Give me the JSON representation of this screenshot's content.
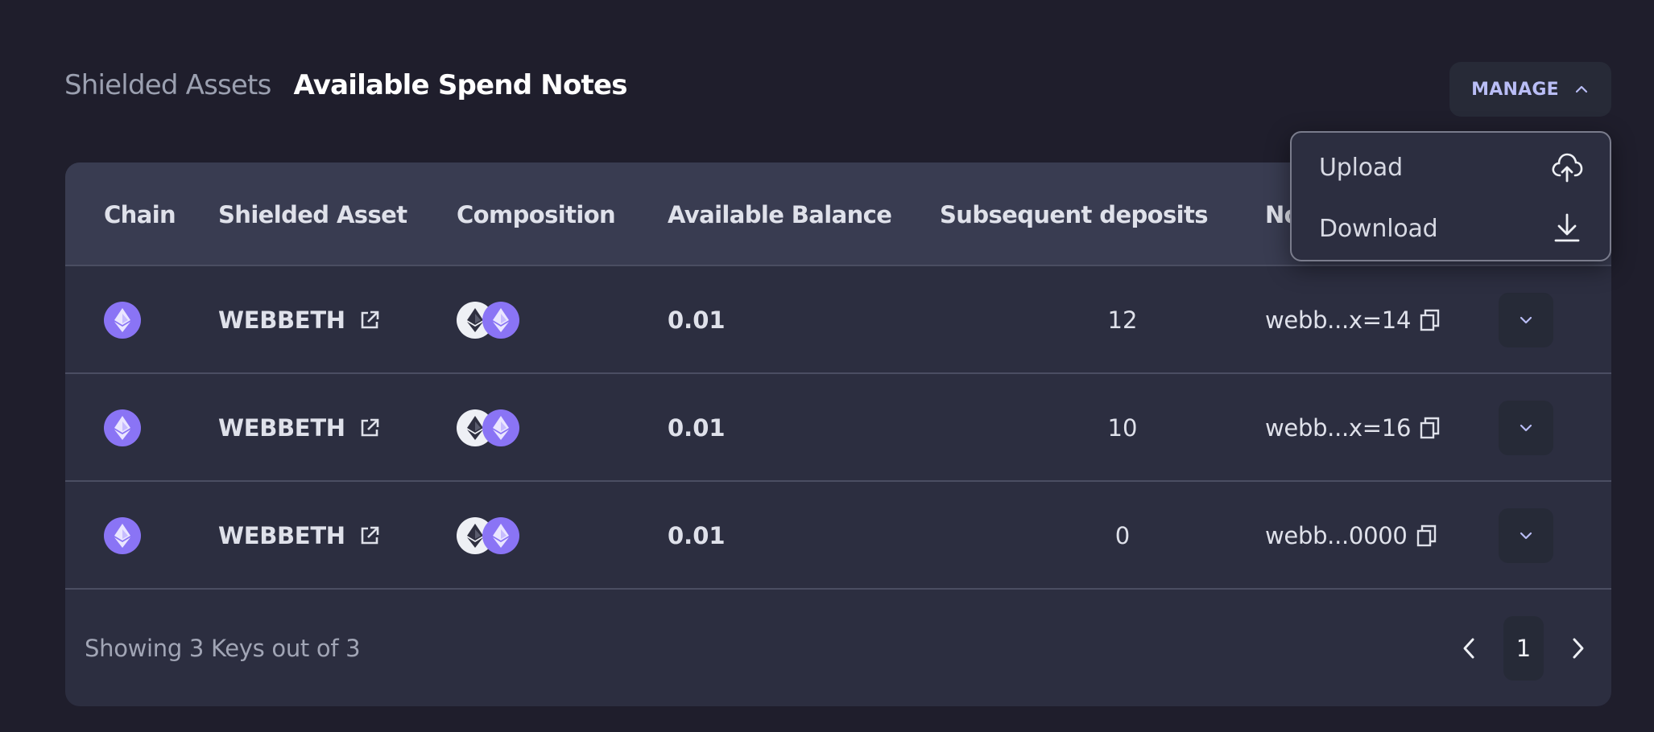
{
  "tabs": [
    {
      "label": "Shielded Assets",
      "active": false
    },
    {
      "label": "Available Spend Notes",
      "active": true
    }
  ],
  "manage": {
    "label": "MANAGE",
    "icon": "chevron-up-icon",
    "menu": [
      {
        "label": "Upload",
        "icon": "cloud-upload-icon"
      },
      {
        "label": "Download",
        "icon": "download-icon"
      }
    ]
  },
  "table": {
    "columns": [
      "Chain",
      "Shielded Asset",
      "Composition",
      "Available Balance",
      "Subsequent deposits",
      "Note"
    ],
    "rows": [
      {
        "chain_icon": "ethereum-icon",
        "asset": "WEBBETH",
        "composition": [
          "ethereum-icon",
          "webb-ethereum-icon"
        ],
        "balance": "0.01",
        "subsequent_deposits": "12",
        "note": "webb...x=14"
      },
      {
        "chain_icon": "ethereum-icon",
        "asset": "WEBBETH",
        "composition": [
          "ethereum-icon",
          "webb-ethereum-icon"
        ],
        "balance": "0.01",
        "subsequent_deposits": "10",
        "note": "webb...x=16"
      },
      {
        "chain_icon": "ethereum-icon",
        "asset": "WEBBETH",
        "composition": [
          "ethereum-icon",
          "webb-ethereum-icon"
        ],
        "balance": "0.01",
        "subsequent_deposits": "0",
        "note": "webb...0000"
      }
    ]
  },
  "footer": {
    "showing_text": "Showing 3 Keys out of 3",
    "current_page": "1"
  },
  "colors": {
    "background": "#1f1e2c",
    "card": "#2c2e40",
    "header": "#393c51",
    "accent": "#b9bdf5",
    "eth_purple": "#8a74f5"
  }
}
